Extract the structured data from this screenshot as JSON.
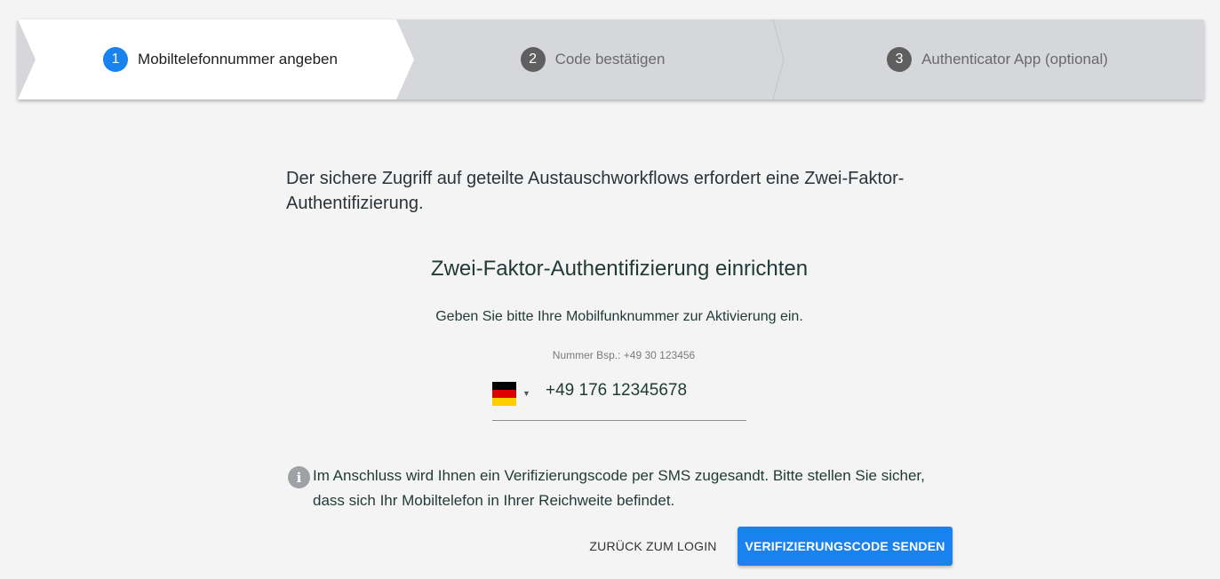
{
  "stepper": {
    "steps": [
      {
        "number": "1",
        "label": "Mobiltelefonnummer angeben",
        "state": "active"
      },
      {
        "number": "2",
        "label": "Code bestätigen",
        "state": "inactive"
      },
      {
        "number": "3",
        "label": "Authenticator App (optional)",
        "state": "inactive"
      }
    ]
  },
  "main": {
    "intro": "Der sichere Zugriff auf geteilte Austauschworkflows erfordert eine Zwei-Faktor-Authentifizierung.",
    "title": "Zwei-Faktor-Authentifizierung einrichten",
    "instruction": "Geben Sie bitte Ihre Mobilfunknummer zur Aktivierung ein.",
    "phone": {
      "hint": "Nummer Bsp.: +49 30 123456",
      "country_icon": "germany-flag-icon",
      "value": "+49 176 12345678"
    },
    "info": {
      "icon": "info-icon",
      "text_line1": "Im Anschluss wird Ihnen ein Verifizierungscode per SMS zugesandt. Bitte stellen Sie sicher,",
      "text_line2": "dass sich Ihr Mobiltelefon in Ihrer Reichweite befindet."
    },
    "actions": {
      "back_label": "ZURÜCK ZUM LOGIN",
      "send_label": "VERIFIZIERUNGSCODE SENDEN"
    }
  },
  "colors": {
    "accent": "#1a82ee",
    "background": "#f4f4f4",
    "stepper_inactive": "#d6d7da",
    "text_dark": "#1f3a35"
  }
}
